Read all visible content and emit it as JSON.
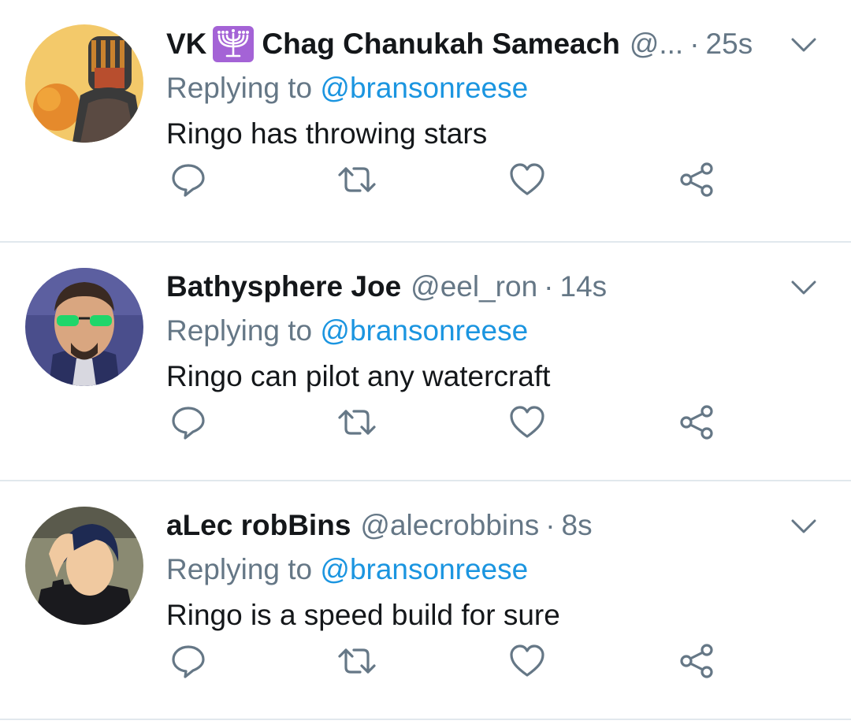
{
  "tweets": [
    {
      "name_prefix": "VK",
      "name_suffix": "Chag Chanukah Sameach",
      "handle": "@...",
      "time": "25s",
      "replying_prefix": "Replying to",
      "replying_to": "@bransonreese",
      "text": "Ringo has throwing stars",
      "badge_icon": "menorah-icon",
      "badge_color": "#a463d6"
    },
    {
      "name": "Bathysphere Joe",
      "handle": "@eel_ron",
      "time": "14s",
      "replying_prefix": "Replying to",
      "replying_to": "@bransonreese",
      "text": "Ringo can pilot any watercraft"
    },
    {
      "name": "aLec robBins",
      "handle": "@alecrobbins",
      "time": "8s",
      "replying_prefix": "Replying to",
      "replying_to": "@bransonreese",
      "text": "Ringo is a speed build for sure"
    }
  ],
  "separator": "·",
  "colors": {
    "text_primary": "#14171a",
    "text_secondary": "#657786",
    "link": "#1b95e0",
    "icon": "#657786",
    "divider": "#e1e8ed"
  },
  "icons": {
    "reply": "reply-icon",
    "retweet": "retweet-icon",
    "like": "heart-icon",
    "share": "share-icon",
    "menu": "chevron-down-icon"
  }
}
